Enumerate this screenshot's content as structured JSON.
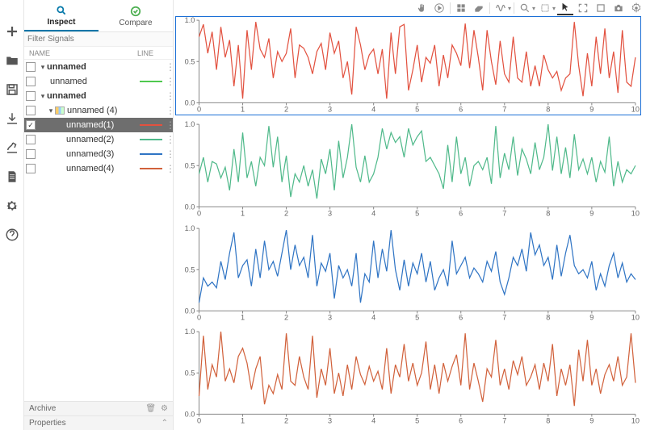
{
  "tabs": {
    "inspect": "Inspect",
    "compare": "Compare"
  },
  "filter_placeholder": "Filter Signals",
  "columns": {
    "name": "NAME",
    "line": "LINE"
  },
  "tree": {
    "group_a": {
      "label": "unnamed"
    },
    "sig_a": {
      "label": "unnamed",
      "color": "#4fc94f"
    },
    "group_b": {
      "label": "unnamed"
    },
    "run": {
      "label": "unnamed",
      "count": "(4)"
    },
    "s1": {
      "label": "unnamed(1)",
      "color": "#e2513f"
    },
    "s2": {
      "label": "unnamed(2)",
      "color": "#4fb98a"
    },
    "s3": {
      "label": "unnamed(3)",
      "color": "#2f74c4"
    },
    "s4": {
      "label": "unnamed(4)",
      "color": "#d1613b"
    }
  },
  "sections": {
    "archive": "Archive",
    "properties": "Properties"
  },
  "chart_data": {
    "type": "line",
    "xlim": [
      0,
      10
    ],
    "ylim": [
      0,
      1.0
    ],
    "xticks": [
      0,
      1,
      2,
      3,
      4,
      5,
      6,
      7,
      8,
      9,
      10
    ],
    "yticks": [
      0,
      0.5,
      1.0
    ],
    "series": [
      {
        "name": "unnamed(1)",
        "color": "#e2513f",
        "selected": true,
        "x_step": 0.1,
        "values": [
          0.8,
          0.95,
          0.6,
          0.86,
          0.4,
          0.92,
          0.55,
          0.76,
          0.2,
          0.7,
          0.05,
          0.88,
          0.4,
          0.98,
          0.65,
          0.55,
          0.78,
          0.3,
          0.62,
          0.5,
          0.6,
          0.9,
          0.3,
          0.7,
          0.66,
          0.55,
          0.35,
          0.62,
          0.72,
          0.4,
          0.85,
          0.6,
          0.75,
          0.3,
          0.5,
          0.1,
          0.92,
          0.7,
          0.4,
          0.58,
          0.65,
          0.35,
          0.65,
          0.05,
          0.85,
          0.35,
          0.92,
          0.95,
          0.15,
          0.4,
          0.7,
          0.25,
          0.55,
          0.48,
          0.7,
          0.2,
          0.58,
          0.3,
          0.7,
          0.6,
          0.45,
          0.96,
          0.42,
          0.88,
          0.55,
          0.15,
          0.88,
          0.5,
          0.22,
          0.75,
          0.35,
          0.25,
          0.8,
          0.3,
          0.25,
          0.62,
          0.2,
          0.45,
          0.2,
          0.58,
          0.4,
          0.3,
          0.38,
          0.15,
          0.3,
          0.35,
          0.98,
          0.45,
          0.08,
          0.6,
          0.2,
          0.8,
          0.35,
          0.9,
          0.3,
          0.62,
          0.12,
          0.88,
          0.25,
          0.2,
          0.55
        ]
      },
      {
        "name": "unnamed(2)",
        "color": "#4fb98a",
        "selected": false,
        "x_step": 0.1,
        "values": [
          0.4,
          0.6,
          0.3,
          0.55,
          0.52,
          0.35,
          0.48,
          0.2,
          0.7,
          0.3,
          0.9,
          0.35,
          0.55,
          0.25,
          0.6,
          0.5,
          0.98,
          0.48,
          0.85,
          0.3,
          0.62,
          0.12,
          0.4,
          0.3,
          0.5,
          0.25,
          0.45,
          0.1,
          0.58,
          0.4,
          0.7,
          0.2,
          0.8,
          0.35,
          0.6,
          1.0,
          0.48,
          0.3,
          0.62,
          0.3,
          0.4,
          0.6,
          0.95,
          0.7,
          0.9,
          0.78,
          0.85,
          0.6,
          0.95,
          0.75,
          0.85,
          0.92,
          0.55,
          0.6,
          0.5,
          0.4,
          0.22,
          0.75,
          0.3,
          0.85,
          0.4,
          0.6,
          0.25,
          0.5,
          0.55,
          0.45,
          0.6,
          0.28,
          0.98,
          0.35,
          0.65,
          0.45,
          0.85,
          0.38,
          0.7,
          0.58,
          0.4,
          0.78,
          0.45,
          0.6,
          1.0,
          0.44,
          0.85,
          0.4,
          0.72,
          0.35,
          0.88,
          0.45,
          0.58,
          0.4,
          0.6,
          0.3,
          0.55,
          0.42,
          0.85,
          0.25,
          0.55,
          0.3,
          0.45,
          0.4,
          0.5
        ]
      },
      {
        "name": "unnamed(3)",
        "color": "#2f74c4",
        "selected": false,
        "x_step": 0.1,
        "values": [
          0.1,
          0.4,
          0.3,
          0.35,
          0.28,
          0.6,
          0.38,
          0.7,
          0.95,
          0.4,
          0.55,
          0.62,
          0.3,
          0.75,
          0.4,
          0.85,
          0.5,
          0.6,
          0.42,
          0.7,
          0.98,
          0.5,
          0.8,
          0.55,
          0.65,
          0.4,
          0.92,
          0.3,
          0.58,
          0.48,
          0.7,
          0.15,
          0.55,
          0.4,
          0.5,
          0.3,
          0.7,
          0.1,
          0.45,
          0.35,
          0.85,
          0.4,
          0.75,
          0.48,
          0.98,
          0.5,
          0.25,
          0.62,
          0.3,
          0.58,
          0.45,
          0.7,
          0.35,
          0.6,
          0.25,
          0.4,
          0.5,
          0.3,
          0.85,
          0.45,
          0.55,
          0.65,
          0.4,
          0.52,
          0.45,
          0.35,
          0.6,
          0.48,
          0.72,
          0.35,
          0.2,
          0.4,
          0.65,
          0.55,
          0.75,
          0.48,
          0.95,
          0.68,
          0.8,
          0.55,
          0.65,
          0.38,
          0.8,
          0.42,
          0.7,
          0.92,
          0.55,
          0.45,
          0.5,
          0.4,
          0.6,
          0.25,
          0.45,
          0.3,
          0.55,
          0.7,
          0.4,
          0.58,
          0.35,
          0.45,
          0.38
        ]
      },
      {
        "name": "unnamed(4)",
        "color": "#d1613b",
        "selected": false,
        "x_step": 0.1,
        "values": [
          0.22,
          0.95,
          0.3,
          0.6,
          0.45,
          1.0,
          0.4,
          0.55,
          0.38,
          0.7,
          0.8,
          0.62,
          0.3,
          0.55,
          0.7,
          0.12,
          0.35,
          0.25,
          0.48,
          0.3,
          0.98,
          0.4,
          0.35,
          0.7,
          0.45,
          0.3,
          0.95,
          0.2,
          0.55,
          0.35,
          0.8,
          0.25,
          0.5,
          0.22,
          0.6,
          0.3,
          0.7,
          0.48,
          0.36,
          0.58,
          0.4,
          0.52,
          0.3,
          0.8,
          0.25,
          0.6,
          0.45,
          0.85,
          0.4,
          0.62,
          0.35,
          0.5,
          0.88,
          0.3,
          0.6,
          0.25,
          0.62,
          0.4,
          0.58,
          0.72,
          0.35,
          0.98,
          0.3,
          0.62,
          0.4,
          0.15,
          0.55,
          0.45,
          0.9,
          0.35,
          0.55,
          0.3,
          0.65,
          0.48,
          0.7,
          0.35,
          0.45,
          0.6,
          0.3,
          0.62,
          0.4,
          0.85,
          0.22,
          0.55,
          0.35,
          0.6,
          0.1,
          0.78,
          0.4,
          0.9,
          0.35,
          0.55,
          0.25,
          0.48,
          0.6,
          0.4,
          0.7,
          0.35,
          0.45,
          0.98,
          0.38
        ]
      }
    ]
  }
}
